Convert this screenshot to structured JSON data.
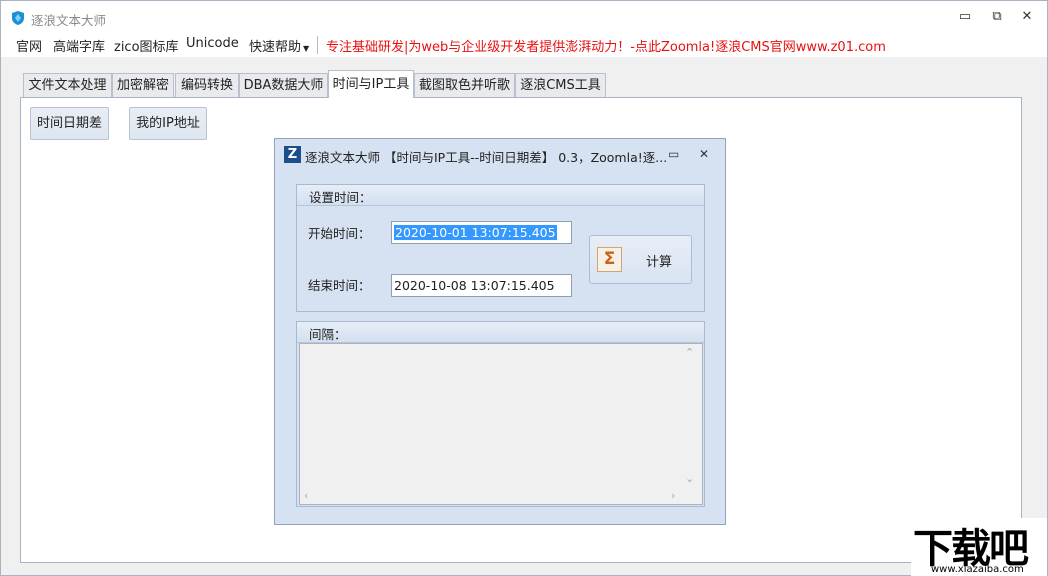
{
  "window": {
    "title": "逐浪文本大师",
    "minimize_glyph": "▭",
    "restore_glyph": "⧉",
    "close_glyph": "✕"
  },
  "menu": {
    "items": [
      "官网",
      "高端字库",
      "zico图标库",
      "Unicode",
      "快速帮助"
    ],
    "promo": "专注基础研发|为web与企业级开发者提供澎湃动力！-点此Zoomla!逐浪CMS官网www.z01.com"
  },
  "tabs": [
    "文件文本处理",
    "加密解密",
    "编码转换",
    "DBA数据大师",
    "时间与IP工具",
    "截图取色并听歌",
    "逐浪CMS工具"
  ],
  "active_tab": "时间与IP工具",
  "tool_buttons": {
    "date_diff": "时间日期差",
    "my_ip": "我的IP地址"
  },
  "dialog": {
    "title": "逐浪文本大师 【时间与IP工具--时间日期差】 0.3，Zoomla!逐...",
    "icon_letter": "Z",
    "group_time": "设置时间：",
    "start_label": "开始时间：",
    "start_value": "2020-10-01 13:07:15.405",
    "end_label": "结束时间：",
    "end_value": "2020-10-08 13:07:15.405",
    "calc_label": "计算",
    "sigma_glyph": "Σ",
    "group_interval": "间隔：",
    "interval_value": ""
  },
  "watermark": {
    "big": "下载吧",
    "small": "www.xiazaiba.com"
  },
  "colors": {
    "accent": "#3399ff",
    "promo": "#e81010",
    "dialog_bg": "#d6e2f1"
  }
}
